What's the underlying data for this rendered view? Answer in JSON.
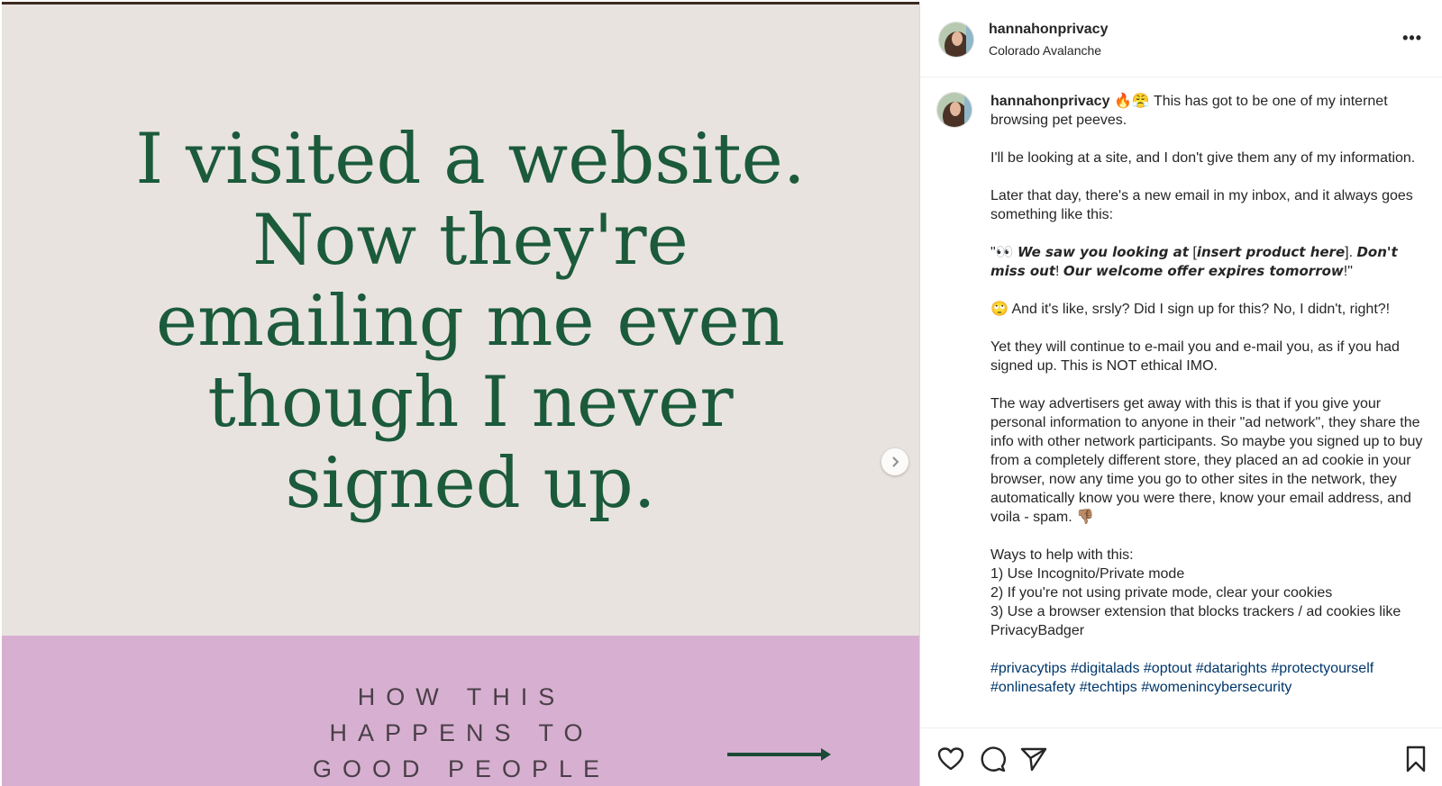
{
  "post": {
    "username": "hannahonprivacy",
    "location": "Colorado Avalanche",
    "more_label": "•••"
  },
  "slide": {
    "headline_lines": [
      "I visited a website.",
      "Now they're",
      "emailing me even",
      "though I never",
      "signed up."
    ],
    "subhead_lines": [
      "HOW THIS",
      "HAPPENS TO",
      "GOOD PEOPLE"
    ],
    "next_icon": "chevron-right-icon"
  },
  "caption": {
    "username": "hannahonprivacy",
    "emoji_intro": "🔥😤",
    "intro": " This has got to be one of my internet browsing pet peeves.",
    "p2": "I'll be looking at a site, and I don't give them any of my information.",
    "p3": "Later that day, there's a new email in my inbox, and it always goes something like this:",
    "quote_open": "\"👀 ",
    "quote_a": "We saw you looking at",
    "quote_b": " [",
    "quote_c": "insert product here",
    "quote_d": "]. ",
    "quote_e": "Don't miss out",
    "quote_f": "! ",
    "quote_g": "Our welcome offer expires tomorrow",
    "quote_close": "!\"",
    "p5": "🙄 And it's like, srsly? Did I sign up for this? No, I didn't, right?!",
    "p6": "Yet they will continue to e-mail you and e-mail you, as if you had signed up. This is NOT ethical IMO.",
    "p7": "The way advertisers get away with this is that if you give your personal information to anyone in their \"ad network\", they share the info with other network participants. So maybe you signed up to buy from a completely different store, they placed an ad cookie in your browser, now any time you go to other sites in the network, they automatically know you were there, know your email address, and voila - spam. 👎🏽",
    "ways_title": "Ways to help with this:",
    "way1": "1) Use Incognito/Private mode",
    "way2": "2) If you're not using private mode, clear your cookies",
    "way3": "3) Use a browser extension that blocks trackers / ad cookies like PrivacyBadger",
    "hashtags": [
      "#privacytips",
      "#digitalads",
      "#optout",
      "#datarights",
      "#protectyourself",
      "#onlinesafety",
      "#techtips",
      "#womenincybersecurity"
    ]
  },
  "actions": {
    "icons": [
      "heart-icon",
      "comment-icon",
      "share-icon",
      "bookmark-icon"
    ]
  },
  "colors": {
    "headline": "#1b5a3b",
    "slide_bg": "#e8e3de",
    "pink_band": "#d7b0d1",
    "hashtag": "#00376b"
  }
}
